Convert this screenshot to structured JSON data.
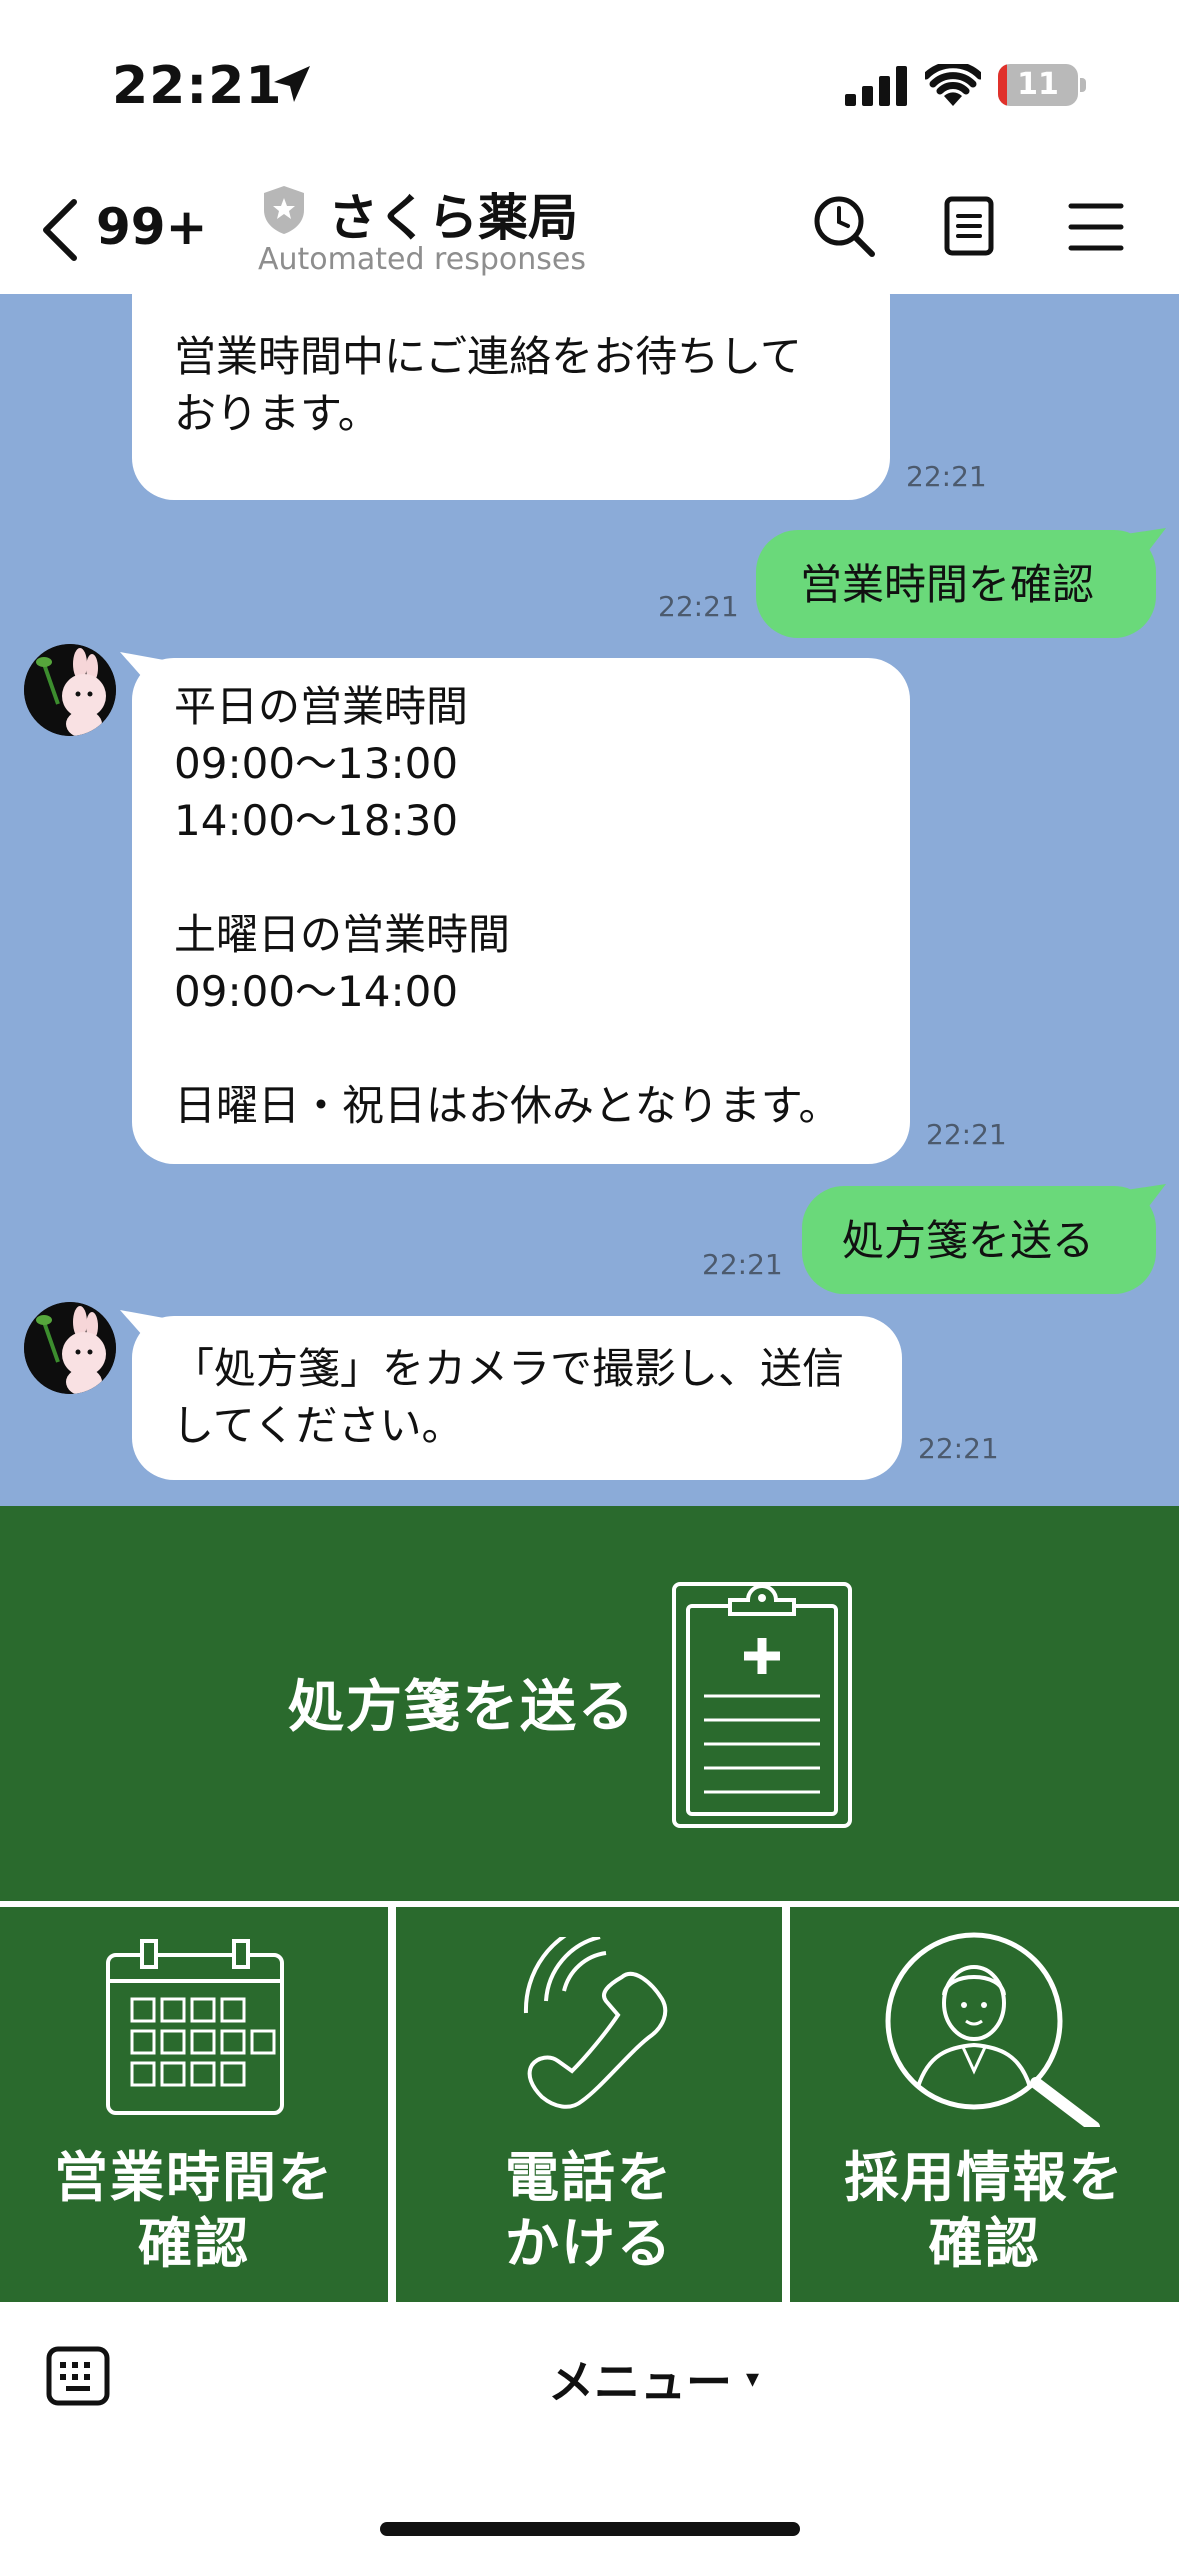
{
  "status_bar": {
    "time": "22:21",
    "battery": "11",
    "battery_level": 0.11
  },
  "header": {
    "unread_count": "99+",
    "title": "さくら薬局",
    "subtitle": "Automated responses"
  },
  "messages": [
    {
      "dir": "in",
      "text": "営業時間中にご連絡をお待ちして\nおります。",
      "time": "22:21"
    },
    {
      "dir": "out",
      "text": "営業時間を確認",
      "time": "22:21"
    },
    {
      "dir": "in",
      "text": "平日の営業時間\n09:00～13:00\n14:00～18:30\n\n土曜日の営業時間\n09:00～14:00\n\n日曜日・祝日はお休みとなります。",
      "time": "22:21"
    },
    {
      "dir": "out",
      "text": "処方箋を送る",
      "time": "22:21"
    },
    {
      "dir": "in",
      "text": "「処方箋」をカメラで撮影し、送信\nしてください。",
      "time": "22:21"
    }
  ],
  "rich_menu": {
    "send_prescription": "処方箋を送る",
    "hours_line1": "営業時間を",
    "hours_line2": "確認",
    "call_line1": "電話を",
    "call_line2": "かける",
    "recruit_line1": "採用情報を",
    "recruit_line2": "確認",
    "tile_color": "#2a6a2d"
  },
  "bottom_bar": {
    "menu_label": "メニュー",
    "caret": "▾"
  }
}
